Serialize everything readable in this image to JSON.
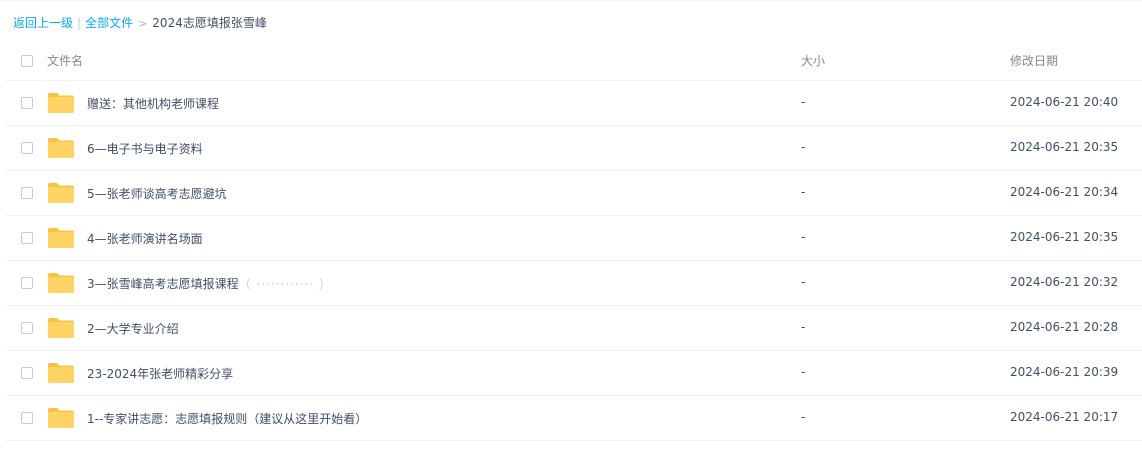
{
  "breadcrumb": {
    "back_label": "返回上一级",
    "separator": "|",
    "all_files_label": "全部文件",
    "arrow": ">",
    "current_label": "2024志愿填报张雪峰"
  },
  "table": {
    "headers": {
      "name": "文件名",
      "size": "大小",
      "modified": "修改日期"
    },
    "rows": [
      {
        "name": "赠送：其他机构老师课程",
        "size": "-",
        "modified": "2024-06-21 20:40"
      },
      {
        "name": "6—电子书与电子资料",
        "size": "-",
        "modified": "2024-06-21 20:35"
      },
      {
        "name": "5—张老师谈高考志愿避坑",
        "size": "-",
        "modified": "2024-06-21 20:34"
      },
      {
        "name": "4—张老师演讲名场面",
        "size": "-",
        "modified": "2024-06-21 20:35"
      },
      {
        "name": "3—张雪峰高考志愿填报课程",
        "name_tail": "（ ············ ）",
        "size": "-",
        "modified": "2024-06-21 20:32"
      },
      {
        "name": "2—大学专业介绍",
        "size": "-",
        "modified": "2024-06-21 20:28"
      },
      {
        "name": "23-2024年张老师精彩分享",
        "size": "-",
        "modified": "2024-06-21 20:39"
      },
      {
        "name": "1--专家讲志愿：志愿填报规则（建议从这里开始看）",
        "size": "-",
        "modified": "2024-06-21 20:17"
      }
    ]
  },
  "icons": {
    "folder": "folder-icon"
  },
  "colors": {
    "link": "#09aaff",
    "text": "#424e67",
    "header_text": "#888888",
    "folder": "#ffd465",
    "folder_tab": "#f5c443"
  }
}
